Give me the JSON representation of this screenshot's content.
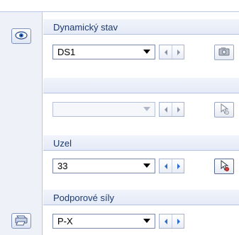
{
  "sections": [
    {
      "label": "Dynamický stav",
      "value": "DS1",
      "enabled": true
    },
    {
      "label": "",
      "value": "",
      "enabled": false
    },
    {
      "label": "Uzel",
      "value": "33",
      "enabled": true
    },
    {
      "label": "Podporové síly",
      "value": "P-X",
      "enabled": true
    }
  ],
  "icons": {
    "sidebar_top": "eye-icon",
    "sidebar_bottom": "print-icon",
    "row1_tool": "view-camera-icon",
    "row2_tool": "pick-cursor-icon",
    "row3_tool": "pick-node-icon"
  }
}
